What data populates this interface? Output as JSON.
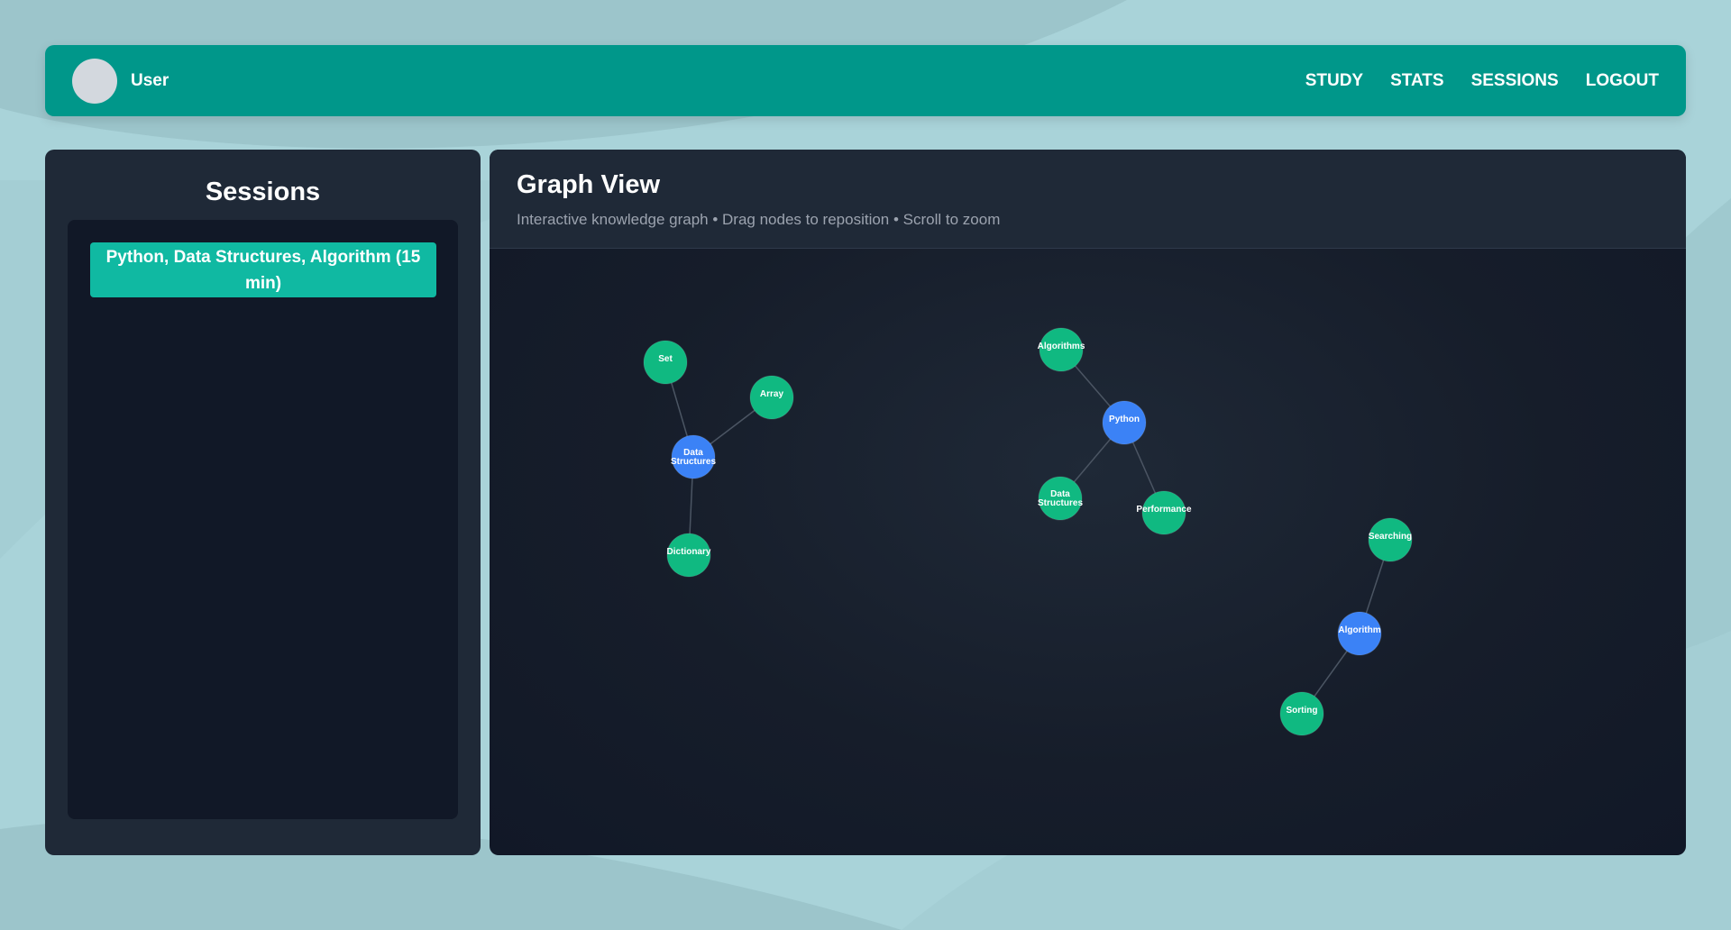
{
  "navbar": {
    "username": "User",
    "links": [
      "STUDY",
      "STATS",
      "SESSIONS",
      "LOGOUT"
    ]
  },
  "sessions": {
    "title": "Sessions",
    "items": [
      "Python, Data Structures, Algorithm (15 min)"
    ]
  },
  "graph": {
    "title": "Graph View",
    "subtitle": "Interactive knowledge graph • Drag nodes to reposition • Scroll to zoom",
    "colors": {
      "central": "#3b82f6",
      "leaf": "#10b981",
      "edge": "#4b5563"
    },
    "nodes": [
      {
        "id": "ds_hub",
        "label": "Data Structures",
        "type": "central"
      },
      {
        "id": "set",
        "label": "Set",
        "type": "leaf"
      },
      {
        "id": "array",
        "label": "Array",
        "type": "leaf"
      },
      {
        "id": "dictionary",
        "label": "Dictionary",
        "type": "leaf"
      },
      {
        "id": "python",
        "label": "Python",
        "type": "central"
      },
      {
        "id": "algorithms",
        "label": "Algorithms",
        "type": "leaf"
      },
      {
        "id": "ds_leaf",
        "label": "Data Structures",
        "type": "leaf"
      },
      {
        "id": "performance",
        "label": "Performance",
        "type": "leaf"
      },
      {
        "id": "algorithm",
        "label": "Algorithm",
        "type": "central"
      },
      {
        "id": "searching",
        "label": "Searching",
        "type": "leaf"
      },
      {
        "id": "sorting",
        "label": "Sorting",
        "type": "leaf"
      }
    ],
    "edges": [
      [
        "ds_hub",
        "set"
      ],
      [
        "ds_hub",
        "array"
      ],
      [
        "ds_hub",
        "dictionary"
      ],
      [
        "python",
        "algorithms"
      ],
      [
        "python",
        "ds_leaf"
      ],
      [
        "python",
        "performance"
      ],
      [
        "algorithm",
        "searching"
      ],
      [
        "algorithm",
        "sorting"
      ]
    ]
  }
}
